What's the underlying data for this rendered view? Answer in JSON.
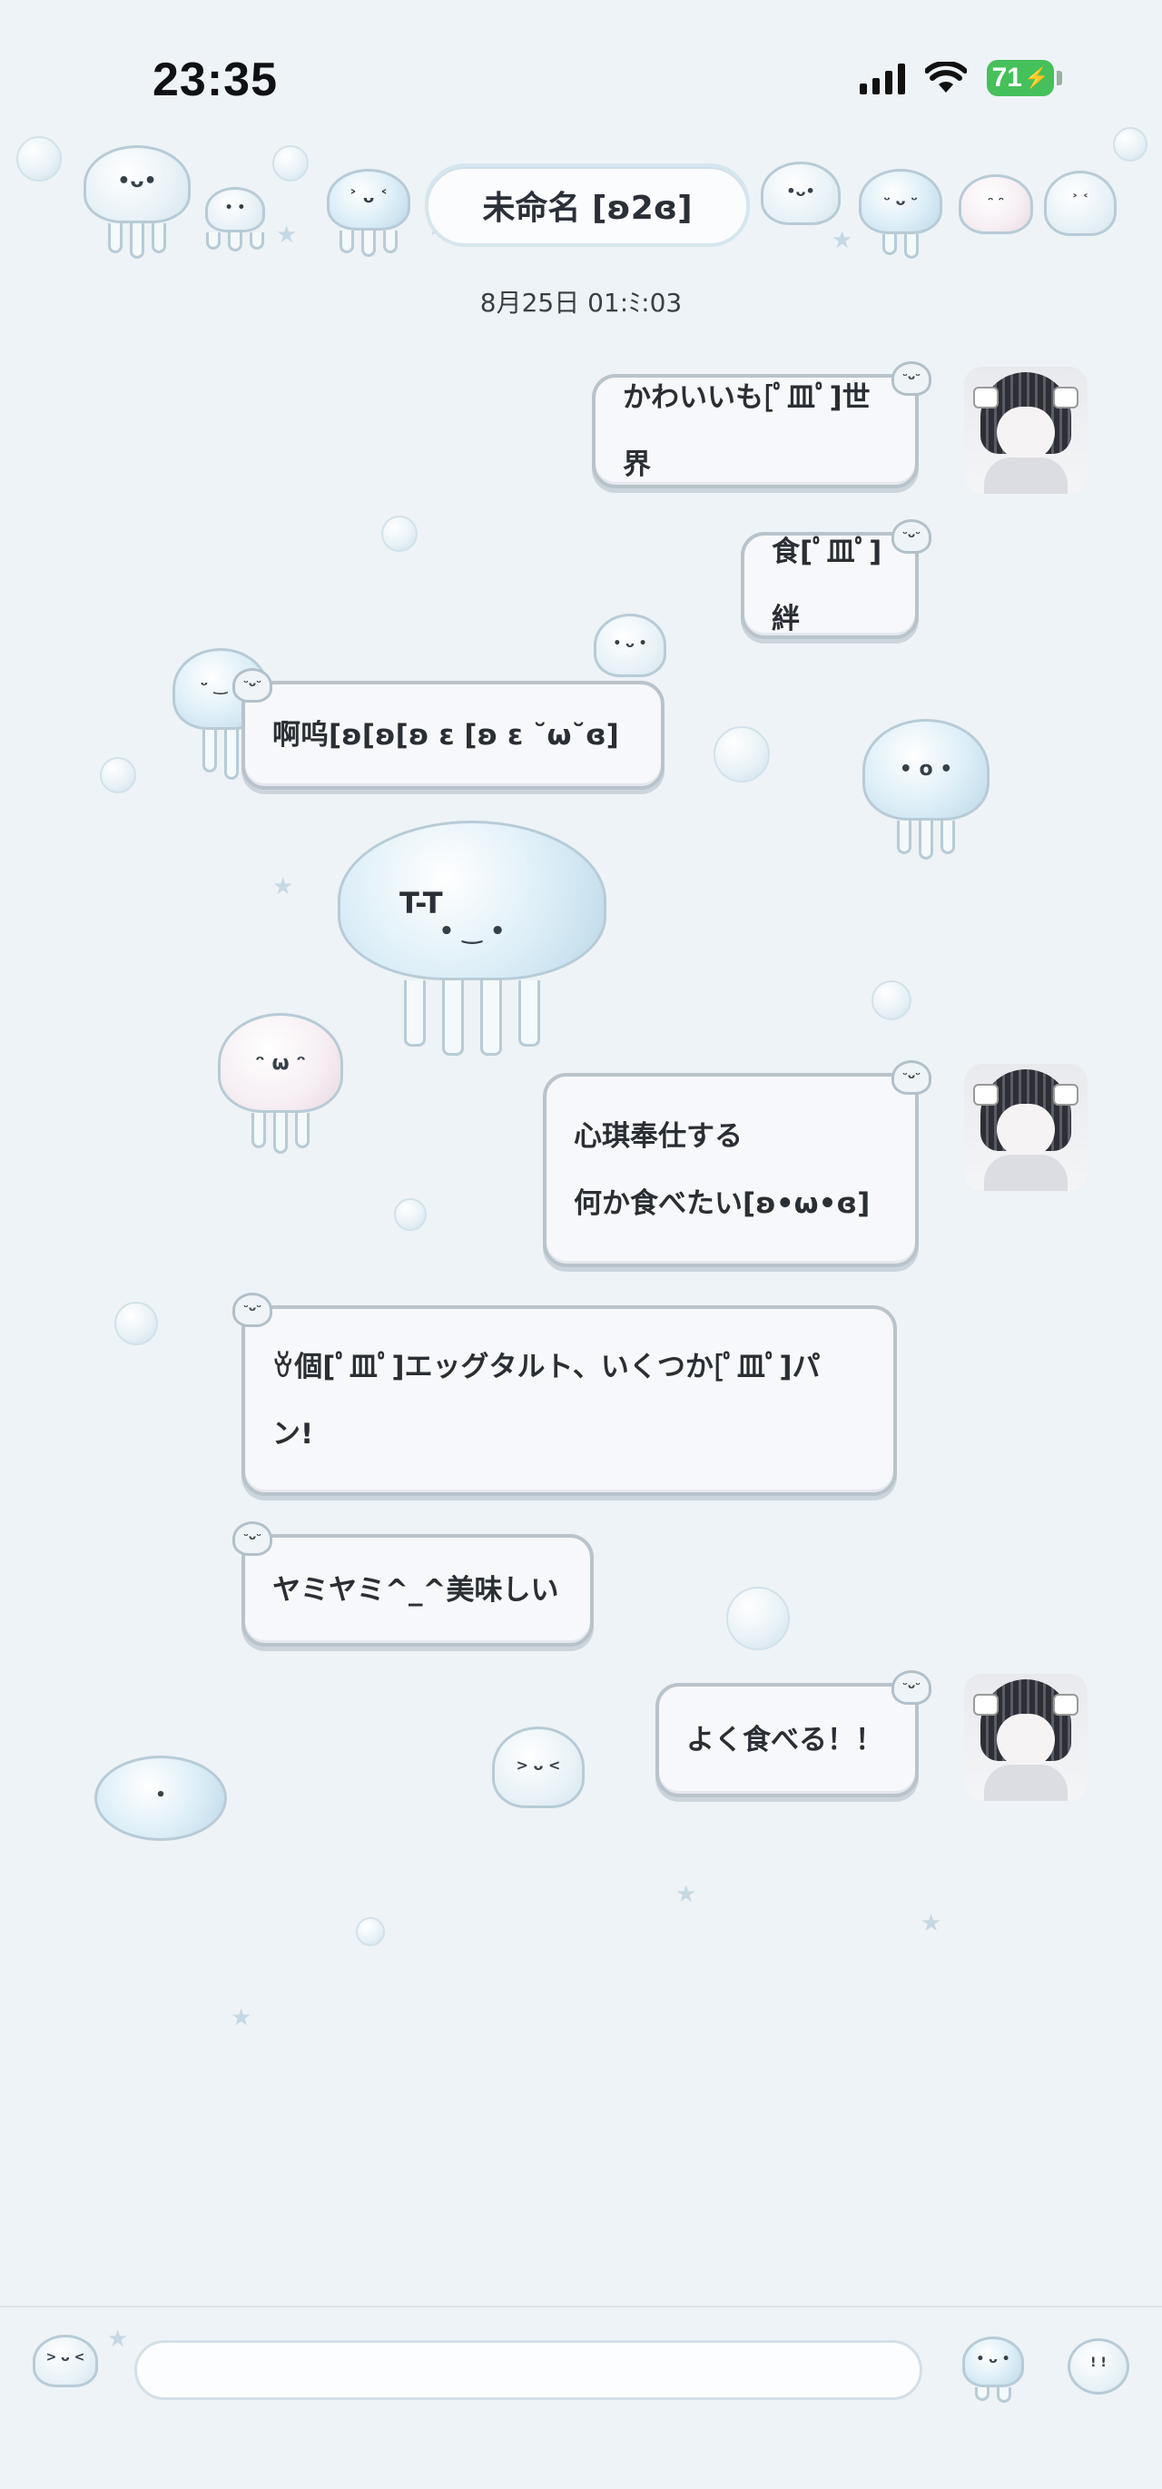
{
  "status_bar": {
    "time": "23:35",
    "battery": "71"
  },
  "header": {
    "title": "未命名 [ʚ2ɞ]"
  },
  "chat": {
    "timestamp": "8月25日 01:ﾐ:03",
    "messages": [
      {
        "side": "right",
        "lines": [
          "かわいいも[ﾟ皿ﾟ]世界"
        ]
      },
      {
        "side": "right",
        "lines": [
          "食[ﾟ皿ﾟ]絆"
        ]
      },
      {
        "side": "left",
        "lines": [
          "啊呜[ʚ[ʚ[ʚ ε [ʚ ε ˘ω˘ɞ]"
        ]
      },
      {
        "side": "left-sticker",
        "lines": [
          "T-T"
        ]
      },
      {
        "side": "right",
        "lines": [
          "心琪奉仕する",
          "何か食べたい[ʚ•ω•ɞ]"
        ]
      },
      {
        "side": "left",
        "lines": [
          "ꈊ個[ﾟ皿ﾟ]エッグタルト、いくつか[ﾟ皿ﾟ]パ",
          "ン!"
        ]
      },
      {
        "side": "left",
        "lines": [
          "ヤミヤミ^_^美味しい"
        ]
      },
      {
        "side": "right",
        "lines": [
          "よく食べる！！"
        ]
      }
    ]
  },
  "input": {
    "placeholder": ""
  },
  "colors": {
    "background": "#eef3f7",
    "bubble_fill": "#f7f8fb",
    "bubble_border": "#b9c3cb",
    "battery_green": "#46c05b"
  },
  "icons": {
    "signal": "cellular-signal-icon",
    "wifi": "wifi-icon",
    "battery": "battery-charging-icon",
    "sticker": "jellyfish-sticker-icon",
    "emoji": "skull-emoji-icon"
  }
}
